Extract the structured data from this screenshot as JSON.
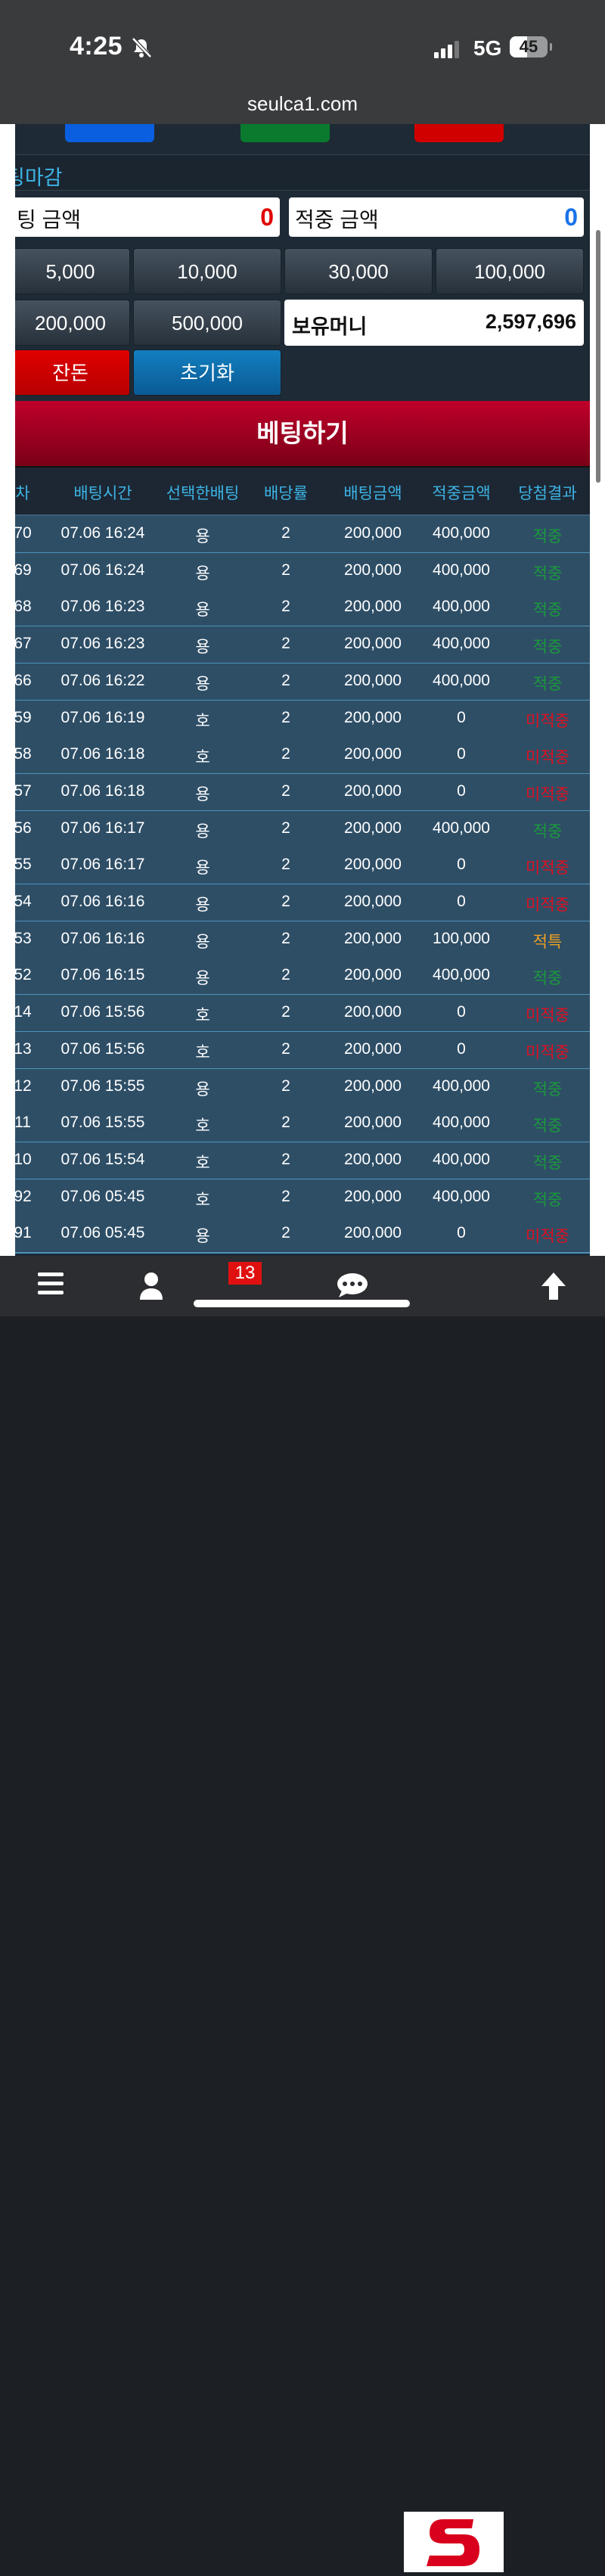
{
  "status_bar": {
    "time": "4:25",
    "network": "5G",
    "battery": "45",
    "battery_level": 0.45
  },
  "browser": {
    "url": "seulca1.com"
  },
  "top_buttons": [
    {
      "color": "#0a5fe0"
    },
    {
      "color": "#0a7a2e"
    },
    {
      "color": "#d10000"
    }
  ],
  "panel": {
    "title": "팅마감"
  },
  "amounts": {
    "bet_label": "팅 금액",
    "bet_value": "0",
    "bet_color": "#e00000",
    "win_label": "적중 금액",
    "win_value": "0",
    "win_color": "#1a73e8"
  },
  "chips": [
    "5,000",
    "10,000",
    "30,000",
    "100,000",
    "200,000",
    "500,000"
  ],
  "balance": {
    "label": "보유머니",
    "value": "2,597,696"
  },
  "actions": {
    "change_label": "잔돈",
    "reset_label": "초기화",
    "bet_label": "베팅하기"
  },
  "history": {
    "headers": [
      "차",
      "배팅시간",
      "선택한배팅",
      "배당률",
      "배팅금액",
      "적중금액",
      "당첨결과"
    ],
    "rows": [
      [
        "70",
        "07.06 16:24",
        "용",
        "2",
        "200,000",
        "400,000",
        "적중"
      ],
      [
        "69",
        "07.06 16:24",
        "용",
        "2",
        "200,000",
        "400,000",
        "적중"
      ],
      [
        "68",
        "07.06 16:23",
        "용",
        "2",
        "200,000",
        "400,000",
        "적중"
      ],
      [
        "67",
        "07.06 16:23",
        "용",
        "2",
        "200,000",
        "400,000",
        "적중"
      ],
      [
        "66",
        "07.06 16:22",
        "용",
        "2",
        "200,000",
        "400,000",
        "적중"
      ],
      [
        "59",
        "07.06 16:19",
        "호",
        "2",
        "200,000",
        "0",
        "미적중"
      ],
      [
        "58",
        "07.06 16:18",
        "호",
        "2",
        "200,000",
        "0",
        "미적중"
      ],
      [
        "57",
        "07.06 16:18",
        "용",
        "2",
        "200,000",
        "0",
        "미적중"
      ],
      [
        "56",
        "07.06 16:17",
        "용",
        "2",
        "200,000",
        "400,000",
        "적중"
      ],
      [
        "55",
        "07.06 16:17",
        "용",
        "2",
        "200,000",
        "0",
        "미적중"
      ],
      [
        "54",
        "07.06 16:16",
        "용",
        "2",
        "200,000",
        "0",
        "미적중"
      ],
      [
        "53",
        "07.06 16:16",
        "용",
        "2",
        "200,000",
        "100,000",
        "적특"
      ],
      [
        "52",
        "07.06 16:15",
        "용",
        "2",
        "200,000",
        "400,000",
        "적중"
      ],
      [
        "14",
        "07.06 15:56",
        "호",
        "2",
        "200,000",
        "0",
        "미적중"
      ],
      [
        "13",
        "07.06 15:56",
        "호",
        "2",
        "200,000",
        "0",
        "미적중"
      ],
      [
        "12",
        "07.06 15:55",
        "용",
        "2",
        "200,000",
        "400,000",
        "적중"
      ],
      [
        "11",
        "07.06 15:55",
        "호",
        "2",
        "200,000",
        "400,000",
        "적중"
      ],
      [
        "10",
        "07.06 15:54",
        "호",
        "2",
        "200,000",
        "400,000",
        "적중"
      ],
      [
        "92",
        "07.06 05:45",
        "호",
        "2",
        "200,000",
        "400,000",
        "적중"
      ],
      [
        "91",
        "07.06 05:45",
        "용",
        "2",
        "200,000",
        "0",
        "미적중"
      ]
    ],
    "result_colors": {
      "적중": "#1a9a3a",
      "미적중": "#e01020",
      "적특": "#f0a020"
    }
  },
  "bottom_nav": {
    "badge": "13"
  }
}
